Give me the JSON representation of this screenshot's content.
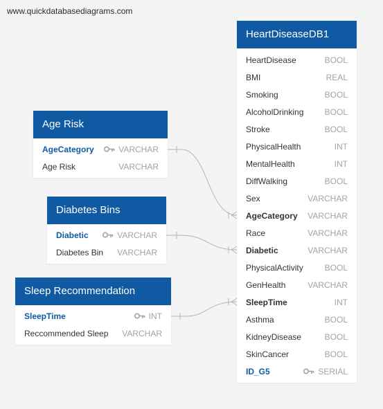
{
  "watermark": "www.quickdatabasediagrams.com",
  "tables": {
    "age_risk": {
      "title": "Age Risk",
      "columns": [
        {
          "name": "AgeCategory",
          "type": "VARCHAR"
        },
        {
          "name": "Age Risk",
          "type": "VARCHAR"
        }
      ]
    },
    "diabetes_bins": {
      "title": "Diabetes Bins",
      "columns": [
        {
          "name": "Diabetic",
          "type": "VARCHAR"
        },
        {
          "name": "Diabetes Bin",
          "type": "VARCHAR"
        }
      ]
    },
    "sleep_recommendation": {
      "title": "Sleep Recommendation",
      "columns": [
        {
          "name": "SleepTime",
          "type": "INT"
        },
        {
          "name": "Reccommended Sleep",
          "type": "VARCHAR"
        }
      ]
    },
    "heart_disease_db": {
      "title": "HeartDiseaseDB1",
      "columns": [
        {
          "name": "HeartDisease",
          "type": "BOOL"
        },
        {
          "name": "BMI",
          "type": "REAL"
        },
        {
          "name": "Smoking",
          "type": "BOOL"
        },
        {
          "name": "AlcoholDrinking",
          "type": "BOOL"
        },
        {
          "name": "Stroke",
          "type": "BOOL"
        },
        {
          "name": "PhysicalHealth",
          "type": "INT"
        },
        {
          "name": "MentalHealth",
          "type": "INT"
        },
        {
          "name": "DiffWalking",
          "type": "BOOL"
        },
        {
          "name": "Sex",
          "type": "VARCHAR"
        },
        {
          "name": "AgeCategory",
          "type": "VARCHAR"
        },
        {
          "name": "Race",
          "type": "VARCHAR"
        },
        {
          "name": "Diabetic",
          "type": "VARCHAR"
        },
        {
          "name": "PhysicalActivity",
          "type": "BOOL"
        },
        {
          "name": "GenHealth",
          "type": "VARCHAR"
        },
        {
          "name": "SleepTime",
          "type": "INT"
        },
        {
          "name": "Asthma",
          "type": "BOOL"
        },
        {
          "name": "KidneyDisease",
          "type": "BOOL"
        },
        {
          "name": "SkinCancer",
          "type": "BOOL"
        },
        {
          "name": "ID_G5",
          "type": "SERIAL"
        }
      ]
    }
  },
  "colors": {
    "header": "#0f5aa3",
    "primary_key_text": "#0f5aa3",
    "type_text": "#a3a3a3",
    "relationship_line": "#b5b5b5"
  },
  "icons": {
    "primary_key": "key-icon"
  }
}
